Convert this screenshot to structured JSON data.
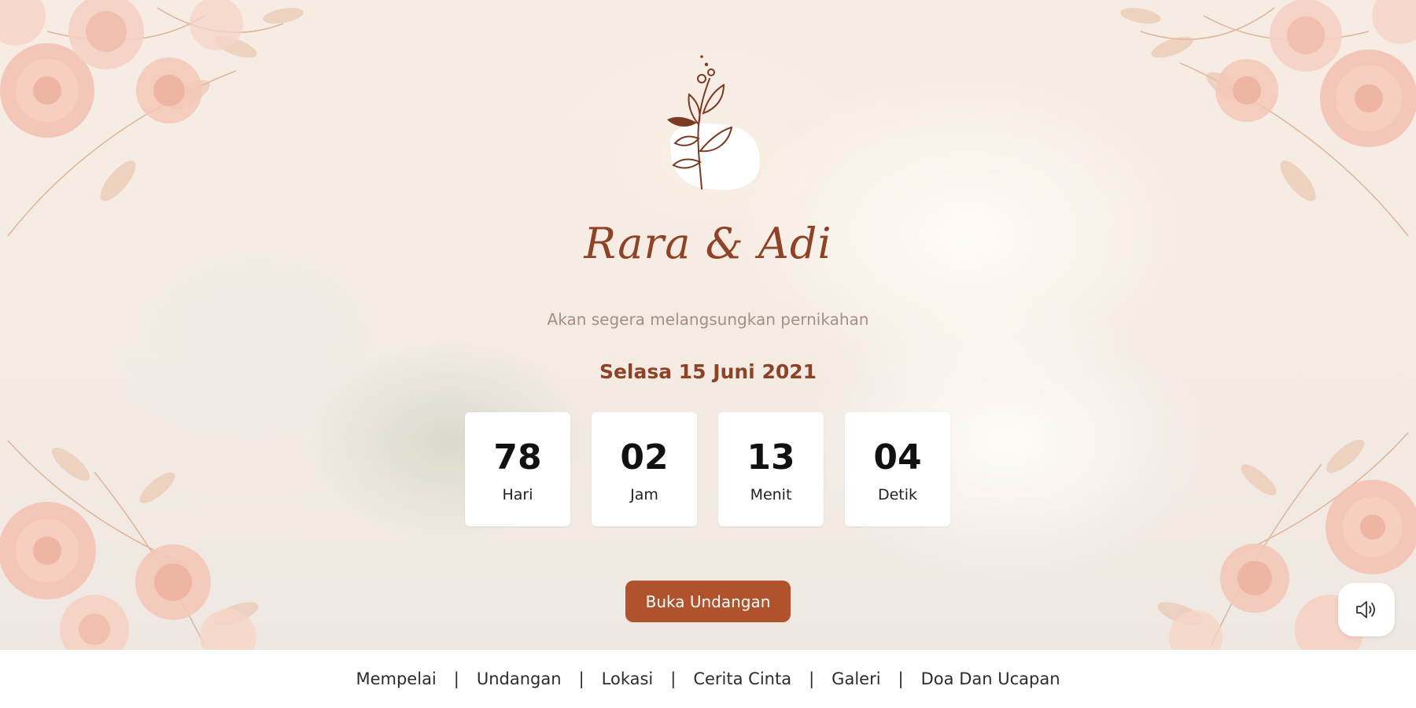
{
  "couple": {
    "names": "Rara & Adi"
  },
  "subtitle": "Akan segera melangsungkan pernikahan",
  "date": "Selasa 15 Juni 2021",
  "countdown": [
    {
      "value": "78",
      "label": "Hari"
    },
    {
      "value": "02",
      "label": "Jam"
    },
    {
      "value": "13",
      "label": "Menit"
    },
    {
      "value": "04",
      "label": "Detik"
    }
  ],
  "open_button": "Buka Undangan",
  "nav": [
    {
      "label": "Mempelai"
    },
    {
      "label": "Undangan"
    },
    {
      "label": "Lokasi"
    },
    {
      "label": "Cerita Cinta"
    },
    {
      "label": "Galeri"
    },
    {
      "label": "Doa Dan Ucapan"
    }
  ],
  "nav_separator": "|",
  "icons": {
    "emblem": "floral-branch-icon",
    "audio": "speaker-volume-icon"
  },
  "colors": {
    "accent": "#b0522c",
    "name": "#8e4226",
    "subtitle": "#a48f86"
  }
}
